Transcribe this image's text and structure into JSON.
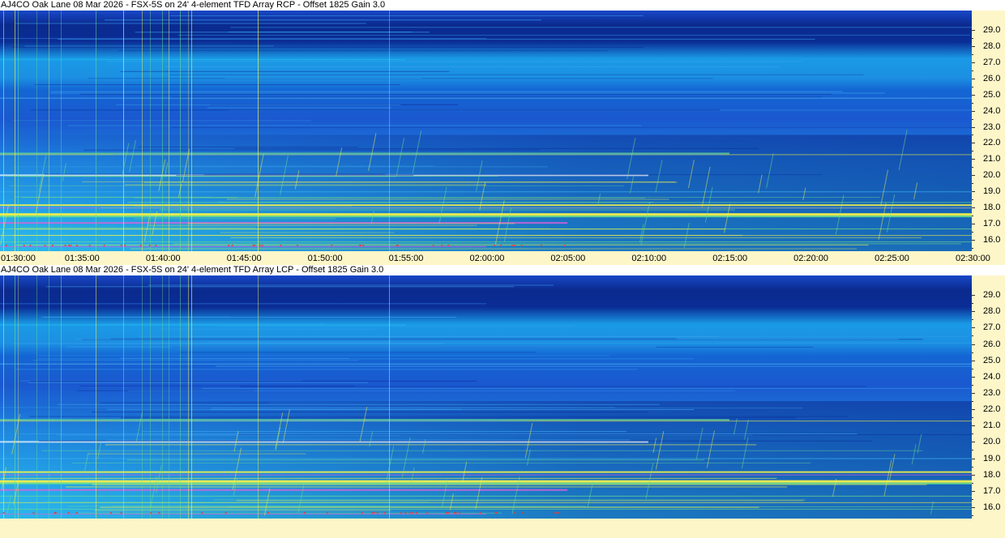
{
  "panels": [
    {
      "title": "AJ4CO Oak Lane 08 Mar 2026 - FSX-5S on 24' 4-element TFD Array RCP  -  Offset 1825  Gain 3.0",
      "polarization": "RCP"
    },
    {
      "title": "AJ4CO Oak Lane 08 Mar 2026 - FSX-5S on 24' 4-element TFD Array LCP  -  Offset 1825  Gain 3.0",
      "polarization": "LCP"
    }
  ],
  "freq_labels": [
    "29.0",
    "28.0",
    "27.0",
    "26.0",
    "25.0",
    "24.0",
    "23.0",
    "22.0",
    "21.0",
    "20.0",
    "19.0",
    "18.0",
    "17.0",
    "16.0"
  ],
  "freq_values": [
    29,
    28,
    27,
    26,
    25,
    24,
    23,
    22,
    21,
    20,
    19,
    18,
    17,
    16
  ],
  "freq_range": [
    15.3,
    30.2
  ],
  "time_labels": [
    "01:30:00",
    "01:35:00",
    "01:40:00",
    "01:45:00",
    "01:50:00",
    "01:55:00",
    "02:00:00",
    "02:05:00",
    "02:10:00",
    "02:15:00",
    "02:20:00",
    "02:25:00",
    "02:30:00"
  ],
  "colors": {
    "axis_background": "#fdf6c8",
    "deep_blue": "#0a2a8c",
    "mid_blue": "#1e5fd6",
    "cyan": "#1fb4f0",
    "green": "#6fe08a",
    "yellow": "#f2f04a",
    "magenta": "#e060d8"
  }
}
